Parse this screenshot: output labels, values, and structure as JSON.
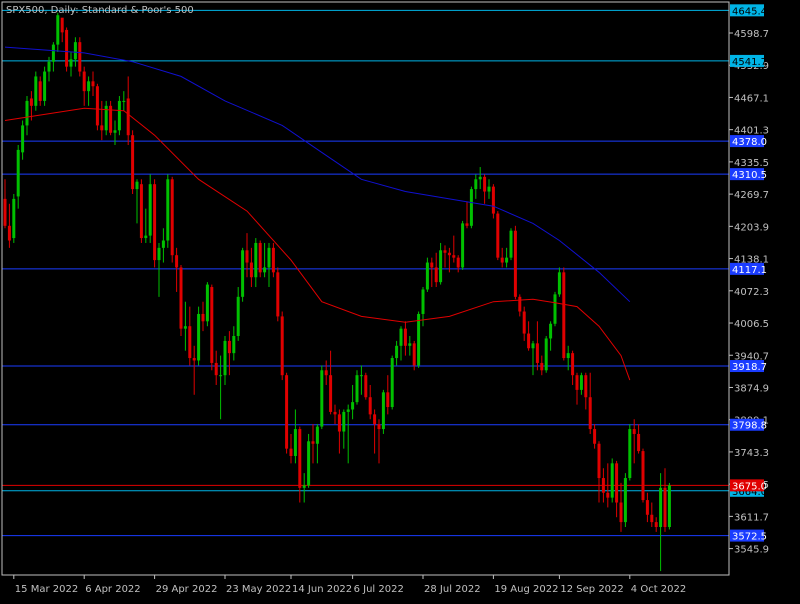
{
  "chart_title": "SPX500, Daily:  Standard & Poor's 500",
  "colors": {
    "background": "#000000",
    "frame": "#c0c0c0",
    "text": "#c0c0c0",
    "bull": "#00c000",
    "bear": "#e00000",
    "ma_fast": "#e00000",
    "ma_slow": "#1010d0",
    "level_blue": "#1a3cff",
    "level_cyan": "#00b4e6",
    "level_red": "#e00000"
  },
  "chart_data": {
    "type": "candlestick",
    "symbol": "SPX500",
    "timeframe": "Daily",
    "description": "Standard & Poor's 500",
    "ylim": [
      3492,
      4662
    ],
    "date_range": [
      "2022-03-11",
      "2022-10-14"
    ],
    "y_ticks": [
      "4598.7",
      "4532.9",
      "4467.1",
      "4401.3",
      "4335.5",
      "4269.7",
      "4203.9",
      "4138.1",
      "4072.3",
      "4006.5",
      "3940.7",
      "3874.9",
      "3809.1",
      "3743.3",
      "3677.5",
      "3611.7",
      "3545.9"
    ],
    "x_ticks": [
      {
        "date": "2022-03-15",
        "label": "15 Mar 2022"
      },
      {
        "date": "2022-04-06",
        "label": "6 Apr 2022"
      },
      {
        "date": "2022-04-29",
        "label": "29 Apr 2022"
      },
      {
        "date": "2022-05-23",
        "label": "23 May 2022"
      },
      {
        "date": "2022-06-14",
        "label": "14 Jun 2022"
      },
      {
        "date": "2022-07-06",
        "label": "6 Jul 2022"
      },
      {
        "date": "2022-07-28",
        "label": "28 Jul 2022"
      },
      {
        "date": "2022-08-19",
        "label": "19 Aug 2022"
      },
      {
        "date": "2022-09-12",
        "label": "12 Sep 2022"
      },
      {
        "date": "2022-10-04",
        "label": "4 Oct 2022"
      }
    ],
    "levels": [
      {
        "price": 4645,
        "label": "4645.4",
        "color": "cyan"
      },
      {
        "price": 4541.7,
        "label": "4541.7",
        "color": "cyan"
      },
      {
        "price": 4378.0,
        "label": "4378.0",
        "color": "blue"
      },
      {
        "price": 4310.5,
        "label": "4310.5",
        "color": "blue"
      },
      {
        "price": 4117.1,
        "label": "4117.1",
        "color": "blue"
      },
      {
        "price": 3918.7,
        "label": "3918.7",
        "color": "blue"
      },
      {
        "price": 3798.8,
        "label": "3798.8",
        "color": "blue"
      },
      {
        "price": 3664.0,
        "label": "3664.0",
        "color": "cyan"
      },
      {
        "price": 3572.5,
        "label": "3572.5",
        "color": "blue"
      }
    ],
    "price_marker": {
      "price": 3675.0,
      "label": "3675.0"
    },
    "candles": [
      [
        "2022-03-11",
        4260,
        4300,
        4200,
        4205
      ],
      [
        "2022-03-14",
        4205,
        4250,
        4160,
        4175
      ],
      [
        "2022-03-15",
        4180,
        4270,
        4170,
        4260
      ],
      [
        "2022-03-16",
        4265,
        4370,
        4240,
        4360
      ],
      [
        "2022-03-17",
        4355,
        4420,
        4340,
        4410
      ],
      [
        "2022-03-18",
        4410,
        4470,
        4390,
        4460
      ],
      [
        "2022-03-21",
        4465,
        4480,
        4420,
        4450
      ],
      [
        "2022-03-22",
        4450,
        4520,
        4440,
        4510
      ],
      [
        "2022-03-23",
        4500,
        4510,
        4450,
        4460
      ],
      [
        "2022-03-24",
        4460,
        4530,
        4450,
        4520
      ],
      [
        "2022-03-25",
        4520,
        4550,
        4500,
        4540
      ],
      [
        "2022-03-28",
        4540,
        4580,
        4520,
        4575
      ],
      [
        "2022-03-29",
        4575,
        4640,
        4560,
        4635
      ],
      [
        "2022-03-30",
        4630,
        4620,
        4580,
        4600
      ],
      [
        "2022-03-31",
        4605,
        4610,
        4520,
        4530
      ],
      [
        "2022-04-01",
        4530,
        4560,
        4510,
        4545
      ],
      [
        "2022-04-04",
        4545,
        4590,
        4530,
        4580
      ],
      [
        "2022-04-05",
        4580,
        4590,
        4510,
        4520
      ],
      [
        "2022-04-06",
        4520,
        4530,
        4450,
        4480
      ],
      [
        "2022-04-07",
        4480,
        4510,
        4450,
        4500
      ],
      [
        "2022-04-08",
        4500,
        4520,
        4470,
        4490
      ],
      [
        "2022-04-11",
        4490,
        4495,
        4400,
        4410
      ],
      [
        "2022-04-12",
        4410,
        4460,
        4380,
        4400
      ],
      [
        "2022-04-13",
        4400,
        4460,
        4390,
        4450
      ],
      [
        "2022-04-14",
        4450,
        4460,
        4390,
        4395
      ],
      [
        "2022-04-18",
        4395,
        4420,
        4370,
        4400
      ],
      [
        "2022-04-19",
        4400,
        4470,
        4390,
        4460
      ],
      [
        "2022-04-20",
        4460,
        4480,
        4440,
        4460
      ],
      [
        "2022-04-21",
        4465,
        4510,
        4370,
        4390
      ],
      [
        "2022-04-22",
        4390,
        4400,
        4270,
        4280
      ],
      [
        "2022-04-25",
        4280,
        4300,
        4210,
        4295
      ],
      [
        "2022-04-26",
        4290,
        4300,
        4170,
        4180
      ],
      [
        "2022-04-27",
        4180,
        4240,
        4170,
        4185
      ],
      [
        "2022-04-28",
        4185,
        4310,
        4170,
        4290
      ],
      [
        "2022-04-29",
        4290,
        4300,
        4120,
        4135
      ],
      [
        "2022-05-02",
        4135,
        4170,
        4060,
        4160
      ],
      [
        "2022-05-03",
        4160,
        4200,
        4130,
        4175
      ],
      [
        "2022-05-04",
        4175,
        4310,
        4160,
        4300
      ],
      [
        "2022-05-05",
        4300,
        4305,
        4130,
        4145
      ],
      [
        "2022-05-06",
        4145,
        4160,
        4070,
        4120
      ],
      [
        "2022-05-09",
        4120,
        4125,
        3980,
        3995
      ],
      [
        "2022-05-10",
        3995,
        4050,
        3950,
        4000
      ],
      [
        "2022-05-11",
        4000,
        4040,
        3920,
        3935
      ],
      [
        "2022-05-12",
        3935,
        3960,
        3860,
        3930
      ],
      [
        "2022-05-13",
        3930,
        4040,
        3920,
        4025
      ],
      [
        "2022-05-16",
        4025,
        4050,
        3990,
        4010
      ],
      [
        "2022-05-17",
        4010,
        4090,
        4000,
        4085
      ],
      [
        "2022-05-18",
        4080,
        4085,
        3910,
        3925
      ],
      [
        "2022-05-19",
        3925,
        3950,
        3880,
        3900
      ],
      [
        "2022-05-20",
        3900,
        3940,
        3810,
        3900
      ],
      [
        "2022-05-23",
        3900,
        3980,
        3880,
        3970
      ],
      [
        "2022-05-24",
        3970,
        3990,
        3900,
        3945
      ],
      [
        "2022-05-25",
        3945,
        4000,
        3930,
        3980
      ],
      [
        "2022-05-26",
        3980,
        4080,
        3970,
        4060
      ],
      [
        "2022-05-27",
        4060,
        4160,
        4050,
        4155
      ],
      [
        "2022-05-31",
        4155,
        4190,
        4100,
        4130
      ],
      [
        "2022-06-01",
        4130,
        4160,
        4080,
        4100
      ],
      [
        "2022-06-02",
        4100,
        4180,
        4080,
        4170
      ],
      [
        "2022-06-03",
        4170,
        4175,
        4100,
        4110
      ],
      [
        "2022-06-06",
        4110,
        4170,
        4100,
        4120
      ],
      [
        "2022-06-07",
        4120,
        4170,
        4080,
        4160
      ],
      [
        "2022-06-08",
        4160,
        4170,
        4100,
        4110
      ],
      [
        "2022-06-09",
        4110,
        4120,
        4010,
        4020
      ],
      [
        "2022-06-10",
        4020,
        4030,
        3890,
        3900
      ],
      [
        "2022-06-13",
        3900,
        3905,
        3740,
        3750
      ],
      [
        "2022-06-14",
        3750,
        3780,
        3720,
        3735
      ],
      [
        "2022-06-15",
        3735,
        3830,
        3720,
        3790
      ],
      [
        "2022-06-16",
        3790,
        3795,
        3640,
        3670
      ],
      [
        "2022-06-17",
        3670,
        3700,
        3640,
        3675
      ],
      [
        "2022-06-21",
        3675,
        3780,
        3670,
        3765
      ],
      [
        "2022-06-22",
        3765,
        3800,
        3720,
        3760
      ],
      [
        "2022-06-23",
        3760,
        3800,
        3720,
        3795
      ],
      [
        "2022-06-24",
        3795,
        3920,
        3790,
        3910
      ],
      [
        "2022-06-27",
        3910,
        3930,
        3880,
        3900
      ],
      [
        "2022-06-28",
        3900,
        3950,
        3820,
        3825
      ],
      [
        "2022-06-29",
        3825,
        3840,
        3800,
        3820
      ],
      [
        "2022-06-30",
        3820,
        3830,
        3740,
        3785
      ],
      [
        "2022-07-01",
        3785,
        3830,
        3750,
        3825
      ],
      [
        "2022-07-05",
        3825,
        3840,
        3720,
        3830
      ],
      [
        "2022-07-06",
        3830,
        3880,
        3810,
        3845
      ],
      [
        "2022-07-07",
        3845,
        3910,
        3840,
        3900
      ],
      [
        "2022-07-08",
        3900,
        3920,
        3860,
        3900
      ],
      [
        "2022-07-11",
        3900,
        3905,
        3850,
        3855
      ],
      [
        "2022-07-12",
        3855,
        3880,
        3810,
        3820
      ],
      [
        "2022-07-13",
        3820,
        3830,
        3740,
        3800
      ],
      [
        "2022-07-14",
        3800,
        3810,
        3720,
        3790
      ],
      [
        "2022-07-15",
        3790,
        3870,
        3780,
        3865
      ],
      [
        "2022-07-18",
        3865,
        3900,
        3820,
        3835
      ],
      [
        "2022-07-19",
        3835,
        3940,
        3830,
        3935
      ],
      [
        "2022-07-20",
        3935,
        3970,
        3920,
        3960
      ],
      [
        "2022-07-21",
        3960,
        4000,
        3930,
        3995
      ],
      [
        "2022-07-22",
        3995,
        4010,
        3940,
        3960
      ],
      [
        "2022-07-25",
        3960,
        3980,
        3940,
        3965
      ],
      [
        "2022-07-26",
        3965,
        3970,
        3910,
        3920
      ],
      [
        "2022-07-27",
        3920,
        4030,
        3915,
        4025
      ],
      [
        "2022-07-28",
        4025,
        4080,
        4000,
        4075
      ],
      [
        "2022-07-29",
        4075,
        4140,
        4070,
        4130
      ],
      [
        "2022-08-01",
        4130,
        4140,
        4080,
        4120
      ],
      [
        "2022-08-02",
        4120,
        4150,
        4080,
        4090
      ],
      [
        "2022-08-03",
        4090,
        4170,
        4085,
        4155
      ],
      [
        "2022-08-04",
        4155,
        4165,
        4120,
        4150
      ],
      [
        "2022-08-05",
        4150,
        4160,
        4110,
        4145
      ],
      [
        "2022-08-08",
        4145,
        4185,
        4130,
        4140
      ],
      [
        "2022-08-09",
        4140,
        4145,
        4110,
        4120
      ],
      [
        "2022-08-10",
        4120,
        4215,
        4115,
        4210
      ],
      [
        "2022-08-11",
        4210,
        4255,
        4200,
        4205
      ],
      [
        "2022-08-12",
        4205,
        4285,
        4200,
        4280
      ],
      [
        "2022-08-15",
        4280,
        4310,
        4260,
        4300
      ],
      [
        "2022-08-16",
        4300,
        4325,
        4280,
        4305
      ],
      [
        "2022-08-17",
        4305,
        4310,
        4250,
        4275
      ],
      [
        "2022-08-18",
        4275,
        4300,
        4260,
        4285
      ],
      [
        "2022-08-19",
        4285,
        4290,
        4220,
        4230
      ],
      [
        "2022-08-22",
        4230,
        4235,
        4135,
        4140
      ],
      [
        "2022-08-23",
        4140,
        4160,
        4120,
        4130
      ],
      [
        "2022-08-24",
        4130,
        4160,
        4120,
        4140
      ],
      [
        "2022-08-25",
        4140,
        4200,
        4135,
        4195
      ],
      [
        "2022-08-26",
        4195,
        4205,
        4055,
        4060
      ],
      [
        "2022-08-29",
        4060,
        4065,
        4020,
        4030
      ],
      [
        "2022-08-30",
        4030,
        4040,
        3970,
        3985
      ],
      [
        "2022-08-31",
        3985,
        4010,
        3950,
        3955
      ],
      [
        "2022-09-01",
        3955,
        3970,
        3900,
        3965
      ],
      [
        "2022-09-02",
        3965,
        4010,
        3910,
        3925
      ],
      [
        "2022-09-06",
        3925,
        3940,
        3900,
        3910
      ],
      [
        "2022-09-07",
        3910,
        3980,
        3905,
        3975
      ],
      [
        "2022-09-08",
        3975,
        4010,
        3950,
        4005
      ],
      [
        "2022-09-09",
        4005,
        4070,
        4000,
        4065
      ],
      [
        "2022-09-12",
        4065,
        4120,
        4060,
        4110
      ],
      [
        "2022-09-13",
        4110,
        4120,
        3930,
        3935
      ],
      [
        "2022-09-14",
        3935,
        3960,
        3910,
        3945
      ],
      [
        "2022-09-15",
        3945,
        3950,
        3880,
        3900
      ],
      [
        "2022-09-16",
        3900,
        3905,
        3840,
        3870
      ],
      [
        "2022-09-19",
        3870,
        3905,
        3860,
        3900
      ],
      [
        "2022-09-20",
        3900,
        3905,
        3830,
        3855
      ],
      [
        "2022-09-21",
        3855,
        3905,
        3780,
        3790
      ],
      [
        "2022-09-22",
        3790,
        3800,
        3750,
        3760
      ],
      [
        "2022-09-23",
        3760,
        3765,
        3640,
        3690
      ],
      [
        "2022-09-26",
        3690,
        3710,
        3640,
        3660
      ],
      [
        "2022-09-27",
        3660,
        3720,
        3630,
        3650
      ],
      [
        "2022-09-28",
        3650,
        3730,
        3640,
        3720
      ],
      [
        "2022-09-29",
        3720,
        3725,
        3610,
        3640
      ],
      [
        "2022-09-30",
        3640,
        3680,
        3580,
        3600
      ],
      [
        "2022-10-03",
        3600,
        3700,
        3590,
        3690
      ],
      [
        "2022-10-04",
        3690,
        3800,
        3685,
        3790
      ],
      [
        "2022-10-05",
        3790,
        3810,
        3720,
        3780
      ],
      [
        "2022-10-06",
        3780,
        3800,
        3740,
        3745
      ],
      [
        "2022-10-07",
        3745,
        3750,
        3640,
        3645
      ],
      [
        "2022-10-10",
        3645,
        3660,
        3600,
        3615
      ],
      [
        "2022-10-11",
        3615,
        3640,
        3590,
        3600
      ],
      [
        "2022-10-12",
        3600,
        3610,
        3580,
        3590
      ],
      [
        "2022-10-13",
        3590,
        3700,
        3500,
        3670
      ],
      [
        "2022-10-14",
        3670,
        3710,
        3580,
        3590
      ],
      [
        "2022-10-17",
        3590,
        3680,
        3585,
        3675
      ]
    ],
    "series": [
      {
        "id": "ma_fast",
        "points": [
          [
            "2022-03-11",
            4420
          ],
          [
            "2022-04-06",
            4445
          ],
          [
            "2022-04-20",
            4440
          ],
          [
            "2022-04-29",
            4390
          ],
          [
            "2022-05-13",
            4300
          ],
          [
            "2022-05-31",
            4235
          ],
          [
            "2022-06-14",
            4135
          ],
          [
            "2022-06-24",
            4050
          ],
          [
            "2022-07-08",
            4020
          ],
          [
            "2022-07-22",
            4008
          ],
          [
            "2022-08-05",
            4020
          ],
          [
            "2022-08-19",
            4050
          ],
          [
            "2022-09-01",
            4055
          ],
          [
            "2022-09-09",
            4048
          ],
          [
            "2022-09-16",
            4040
          ],
          [
            "2022-09-23",
            4000
          ],
          [
            "2022-09-30",
            3940
          ],
          [
            "2022-10-04",
            3890
          ]
        ]
      },
      {
        "id": "ma_slow",
        "points": [
          [
            "2022-03-11",
            4570
          ],
          [
            "2022-04-06",
            4558
          ],
          [
            "2022-04-22",
            4540
          ],
          [
            "2022-05-09",
            4510
          ],
          [
            "2022-05-23",
            4460
          ],
          [
            "2022-06-10",
            4410
          ],
          [
            "2022-06-24",
            4355
          ],
          [
            "2022-07-08",
            4300
          ],
          [
            "2022-07-22",
            4275
          ],
          [
            "2022-08-05",
            4260
          ],
          [
            "2022-08-19",
            4245
          ],
          [
            "2022-09-01",
            4210
          ],
          [
            "2022-09-12",
            4175
          ],
          [
            "2022-09-23",
            4110
          ],
          [
            "2022-10-04",
            4050
          ]
        ]
      }
    ]
  }
}
